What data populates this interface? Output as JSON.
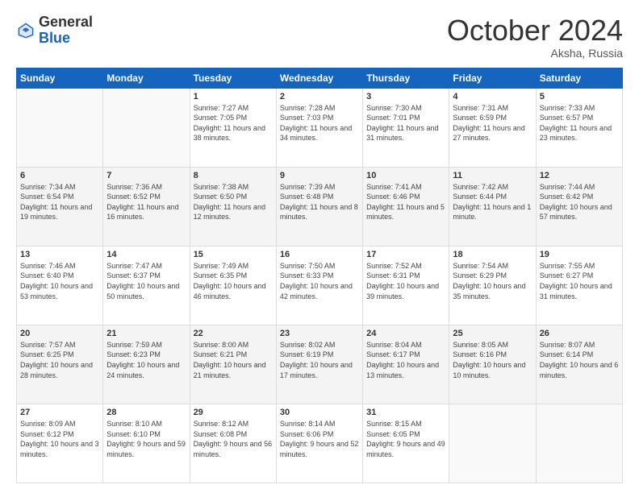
{
  "header": {
    "logo_general": "General",
    "logo_blue": "Blue",
    "month_title": "October 2024",
    "location": "Aksha, Russia"
  },
  "weekdays": [
    "Sunday",
    "Monday",
    "Tuesday",
    "Wednesday",
    "Thursday",
    "Friday",
    "Saturday"
  ],
  "weeks": [
    [
      {
        "day": "",
        "sunrise": "",
        "sunset": "",
        "daylight": ""
      },
      {
        "day": "",
        "sunrise": "",
        "sunset": "",
        "daylight": ""
      },
      {
        "day": "1",
        "sunrise": "Sunrise: 7:27 AM",
        "sunset": "Sunset: 7:05 PM",
        "daylight": "Daylight: 11 hours and 38 minutes."
      },
      {
        "day": "2",
        "sunrise": "Sunrise: 7:28 AM",
        "sunset": "Sunset: 7:03 PM",
        "daylight": "Daylight: 11 hours and 34 minutes."
      },
      {
        "day": "3",
        "sunrise": "Sunrise: 7:30 AM",
        "sunset": "Sunset: 7:01 PM",
        "daylight": "Daylight: 11 hours and 31 minutes."
      },
      {
        "day": "4",
        "sunrise": "Sunrise: 7:31 AM",
        "sunset": "Sunset: 6:59 PM",
        "daylight": "Daylight: 11 hours and 27 minutes."
      },
      {
        "day": "5",
        "sunrise": "Sunrise: 7:33 AM",
        "sunset": "Sunset: 6:57 PM",
        "daylight": "Daylight: 11 hours and 23 minutes."
      }
    ],
    [
      {
        "day": "6",
        "sunrise": "Sunrise: 7:34 AM",
        "sunset": "Sunset: 6:54 PM",
        "daylight": "Daylight: 11 hours and 19 minutes."
      },
      {
        "day": "7",
        "sunrise": "Sunrise: 7:36 AM",
        "sunset": "Sunset: 6:52 PM",
        "daylight": "Daylight: 11 hours and 16 minutes."
      },
      {
        "day": "8",
        "sunrise": "Sunrise: 7:38 AM",
        "sunset": "Sunset: 6:50 PM",
        "daylight": "Daylight: 11 hours and 12 minutes."
      },
      {
        "day": "9",
        "sunrise": "Sunrise: 7:39 AM",
        "sunset": "Sunset: 6:48 PM",
        "daylight": "Daylight: 11 hours and 8 minutes."
      },
      {
        "day": "10",
        "sunrise": "Sunrise: 7:41 AM",
        "sunset": "Sunset: 6:46 PM",
        "daylight": "Daylight: 11 hours and 5 minutes."
      },
      {
        "day": "11",
        "sunrise": "Sunrise: 7:42 AM",
        "sunset": "Sunset: 6:44 PM",
        "daylight": "Daylight: 11 hours and 1 minute."
      },
      {
        "day": "12",
        "sunrise": "Sunrise: 7:44 AM",
        "sunset": "Sunset: 6:42 PM",
        "daylight": "Daylight: 10 hours and 57 minutes."
      }
    ],
    [
      {
        "day": "13",
        "sunrise": "Sunrise: 7:46 AM",
        "sunset": "Sunset: 6:40 PM",
        "daylight": "Daylight: 10 hours and 53 minutes."
      },
      {
        "day": "14",
        "sunrise": "Sunrise: 7:47 AM",
        "sunset": "Sunset: 6:37 PM",
        "daylight": "Daylight: 10 hours and 50 minutes."
      },
      {
        "day": "15",
        "sunrise": "Sunrise: 7:49 AM",
        "sunset": "Sunset: 6:35 PM",
        "daylight": "Daylight: 10 hours and 46 minutes."
      },
      {
        "day": "16",
        "sunrise": "Sunrise: 7:50 AM",
        "sunset": "Sunset: 6:33 PM",
        "daylight": "Daylight: 10 hours and 42 minutes."
      },
      {
        "day": "17",
        "sunrise": "Sunrise: 7:52 AM",
        "sunset": "Sunset: 6:31 PM",
        "daylight": "Daylight: 10 hours and 39 minutes."
      },
      {
        "day": "18",
        "sunrise": "Sunrise: 7:54 AM",
        "sunset": "Sunset: 6:29 PM",
        "daylight": "Daylight: 10 hours and 35 minutes."
      },
      {
        "day": "19",
        "sunrise": "Sunrise: 7:55 AM",
        "sunset": "Sunset: 6:27 PM",
        "daylight": "Daylight: 10 hours and 31 minutes."
      }
    ],
    [
      {
        "day": "20",
        "sunrise": "Sunrise: 7:57 AM",
        "sunset": "Sunset: 6:25 PM",
        "daylight": "Daylight: 10 hours and 28 minutes."
      },
      {
        "day": "21",
        "sunrise": "Sunrise: 7:59 AM",
        "sunset": "Sunset: 6:23 PM",
        "daylight": "Daylight: 10 hours and 24 minutes."
      },
      {
        "day": "22",
        "sunrise": "Sunrise: 8:00 AM",
        "sunset": "Sunset: 6:21 PM",
        "daylight": "Daylight: 10 hours and 21 minutes."
      },
      {
        "day": "23",
        "sunrise": "Sunrise: 8:02 AM",
        "sunset": "Sunset: 6:19 PM",
        "daylight": "Daylight: 10 hours and 17 minutes."
      },
      {
        "day": "24",
        "sunrise": "Sunrise: 8:04 AM",
        "sunset": "Sunset: 6:17 PM",
        "daylight": "Daylight: 10 hours and 13 minutes."
      },
      {
        "day": "25",
        "sunrise": "Sunrise: 8:05 AM",
        "sunset": "Sunset: 6:16 PM",
        "daylight": "Daylight: 10 hours and 10 minutes."
      },
      {
        "day": "26",
        "sunrise": "Sunrise: 8:07 AM",
        "sunset": "Sunset: 6:14 PM",
        "daylight": "Daylight: 10 hours and 6 minutes."
      }
    ],
    [
      {
        "day": "27",
        "sunrise": "Sunrise: 8:09 AM",
        "sunset": "Sunset: 6:12 PM",
        "daylight": "Daylight: 10 hours and 3 minutes."
      },
      {
        "day": "28",
        "sunrise": "Sunrise: 8:10 AM",
        "sunset": "Sunset: 6:10 PM",
        "daylight": "Daylight: 9 hours and 59 minutes."
      },
      {
        "day": "29",
        "sunrise": "Sunrise: 8:12 AM",
        "sunset": "Sunset: 6:08 PM",
        "daylight": "Daylight: 9 hours and 56 minutes."
      },
      {
        "day": "30",
        "sunrise": "Sunrise: 8:14 AM",
        "sunset": "Sunset: 6:06 PM",
        "daylight": "Daylight: 9 hours and 52 minutes."
      },
      {
        "day": "31",
        "sunrise": "Sunrise: 8:15 AM",
        "sunset": "Sunset: 6:05 PM",
        "daylight": "Daylight: 9 hours and 49 minutes."
      },
      {
        "day": "",
        "sunrise": "",
        "sunset": "",
        "daylight": ""
      },
      {
        "day": "",
        "sunrise": "",
        "sunset": "",
        "daylight": ""
      }
    ]
  ]
}
